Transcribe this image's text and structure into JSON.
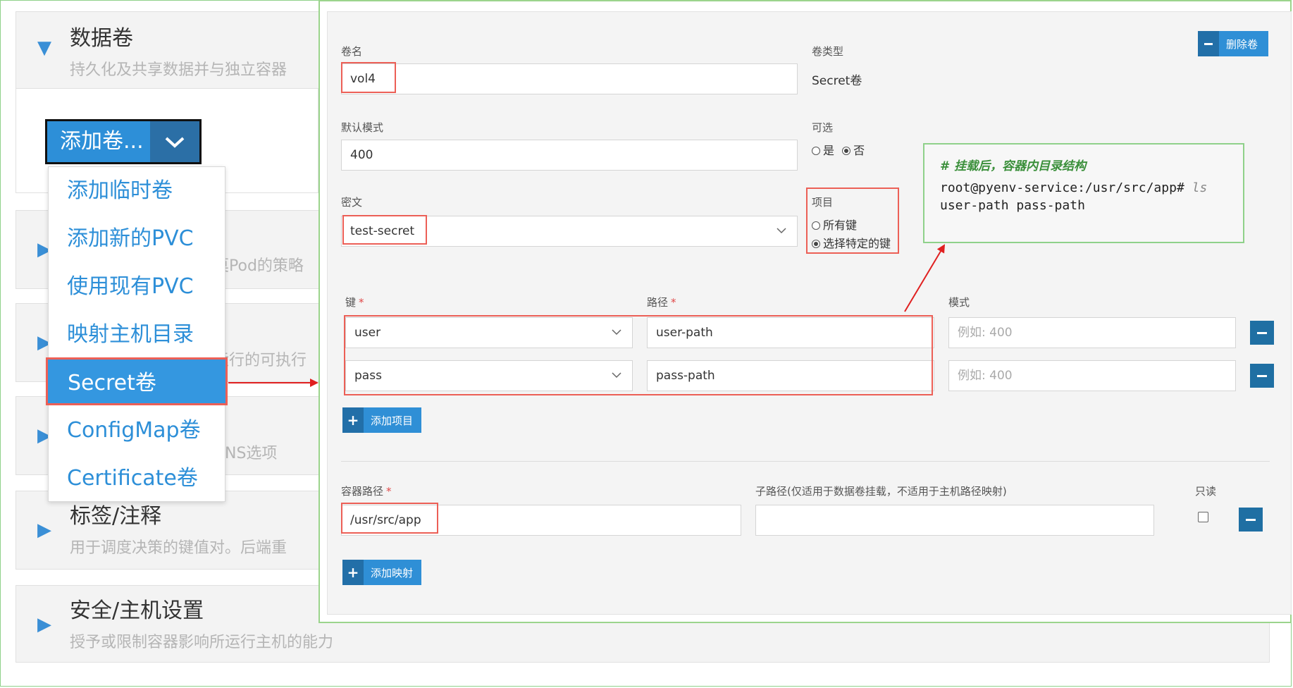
{
  "sections": [
    {
      "title": "数据卷",
      "desc": "持久化及共享数据并与独立容器",
      "expanded": true
    },
    {
      "partial": "莫Pod的策略"
    },
    {
      "partial": "运行的可执行"
    },
    {
      "partial": "NS选项"
    },
    {
      "title": "标签/注释",
      "desc": "用于调度决策的键值对。后端重"
    },
    {
      "title": "安全/主机设置",
      "desc": "授予或限制容器影响所运行主机的能力"
    }
  ],
  "add_volume": {
    "label": "添加卷...",
    "menu": [
      "添加临时卷",
      "添加新的PVC",
      "使用现有PVC",
      "映射主机目录",
      "Secret卷",
      "ConfigMap卷",
      "Certificate卷"
    ],
    "selected": "Secret卷"
  },
  "volume": {
    "name_label": "卷名",
    "name_value": "vol4",
    "type_label": "卷类型",
    "type_value": "Secret卷",
    "delete_label": "删除卷",
    "mode_label": "默认模式",
    "mode_value": "400",
    "optional_label": "可选",
    "optional_yes": "是",
    "optional_no": "否",
    "secret_label": "密文",
    "secret_value": "test-secret",
    "items_label": "项目",
    "items_all": "所有键",
    "items_specific": "选择特定的键",
    "key_col": "键",
    "path_col": "路径",
    "mode_col": "模式",
    "required_mark": "*",
    "rows": [
      {
        "key": "user",
        "path": "user-path",
        "mode_placeholder": "例如: 400"
      },
      {
        "key": "pass",
        "path": "pass-path",
        "mode_placeholder": "例如: 400"
      }
    ],
    "add_item_label": "添加项目",
    "container_path_label": "容器路径",
    "container_path_value": "/usr/src/app",
    "subpath_label": "子路径(仅适用于数据卷挂载，不适用于主机路径映射)",
    "subpath_value": "",
    "readonly_label": "只读",
    "add_mount_label": "添加映射"
  },
  "code_box": {
    "comment": "# 挂载后，容器内目录结构",
    "prompt": "root@pyenv-service:/usr/src/app#",
    "command": " ls",
    "output": "user-path  pass-path"
  },
  "colors": {
    "accent": "#2f8fd6",
    "highlight": "#ec5f56",
    "annotation_arrow": "#e02020",
    "frame_green": "#8fd18a"
  }
}
